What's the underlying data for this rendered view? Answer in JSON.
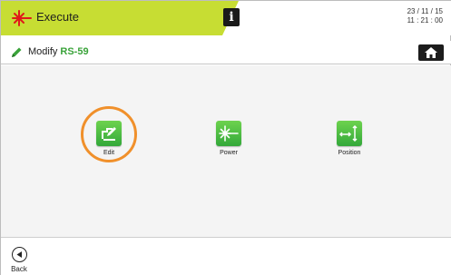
{
  "header": {
    "title": "Execute",
    "info_icon": "i",
    "date": "23 / 11 / 15",
    "time": "11 : 21 : 00",
    "accent_color": "#c7dd33"
  },
  "subheader": {
    "label": "Modify",
    "code": "RS-59",
    "code_color": "#3aa33a"
  },
  "functions": [
    {
      "label": "Edit",
      "icon": "edit-icon",
      "highlighted": true
    },
    {
      "label": "Power",
      "icon": "laser-power-icon",
      "highlighted": false
    },
    {
      "label": "Position",
      "icon": "position-icon",
      "highlighted": false
    }
  ],
  "highlight_color": "#f0902b",
  "footer": {
    "back_label": "Back"
  }
}
